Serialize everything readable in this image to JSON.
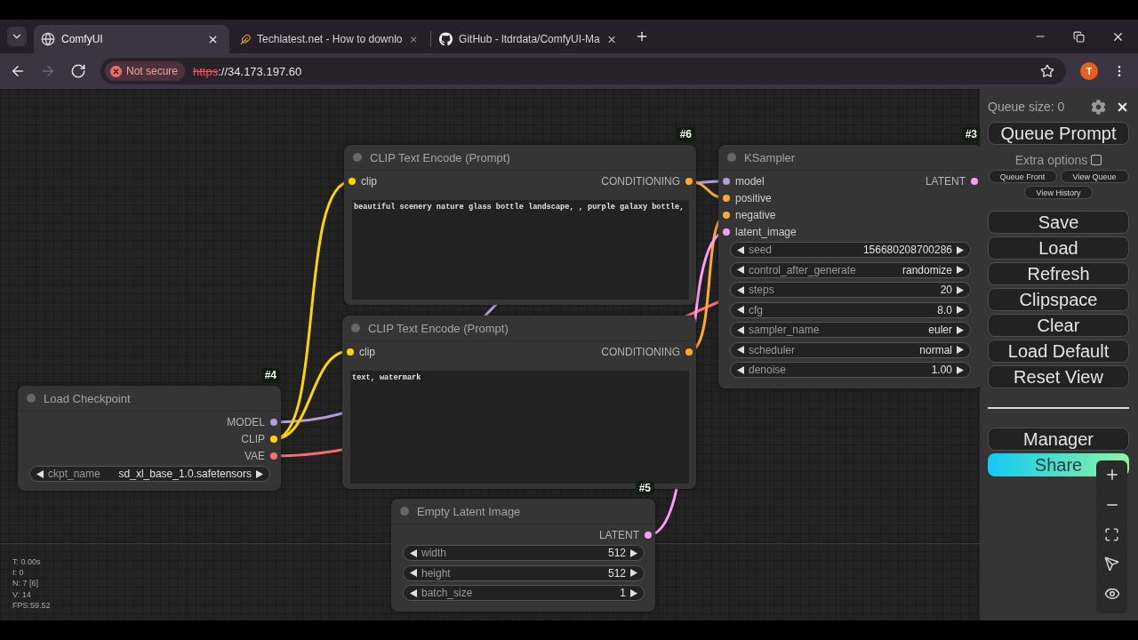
{
  "browser": {
    "tabs": [
      {
        "title": "ComfyUI",
        "selected": true
      },
      {
        "title": "Techlatest.net - How to downlo",
        "selected": false
      },
      {
        "title": "GitHub - ltdrdata/ComfyUI-Ma",
        "selected": false
      }
    ],
    "navigation": [
      {
        "kind": "back",
        "disabled": false
      },
      {
        "kind": "forward",
        "disabled": true
      },
      {
        "kind": "reload",
        "disabled": false
      }
    ],
    "security_chip": "Not secure",
    "url": {
      "scheme": "https",
      "rest": "://34.173.197.60"
    },
    "bookmarked": false,
    "profile_initial": "T"
  },
  "canvas": {
    "nodes": [
      {
        "badge": "#6",
        "title": "CLIP Text Encode (Prompt)",
        "inputs": [
          {
            "name": "clip",
            "color": "#ffd500"
          }
        ],
        "outputs": [
          {
            "name": "CONDITIONING",
            "color": "#ffa931"
          }
        ],
        "prompt": "beautiful scenery nature glass bottle landscape, , purple galaxy bottle,"
      },
      {
        "badge": "#3",
        "title": "KSampler",
        "inputs": [
          {
            "name": "model",
            "color": "#b39ddb"
          },
          {
            "name": "positive",
            "color": "#ffa931"
          },
          {
            "name": "negative",
            "color": "#ffa931"
          },
          {
            "name": "latent_image",
            "color": "#ff9cf9"
          }
        ],
        "outputs": [
          {
            "name": "LATENT",
            "color": "#ff9cf9"
          }
        ],
        "widgets": [
          {
            "name": "seed",
            "value": "156680208700286"
          },
          {
            "name": "control_after_generate",
            "value": "randomize"
          },
          {
            "name": "steps",
            "value": "20"
          },
          {
            "name": "cfg",
            "value": "8.0"
          },
          {
            "name": "sampler_name",
            "value": "euler"
          },
          {
            "name": "scheduler",
            "value": "normal"
          },
          {
            "name": "denoise",
            "value": "1.00"
          }
        ]
      },
      {
        "title": "CLIP Text Encode (Prompt)",
        "inputs": [
          {
            "name": "clip",
            "color": "#ffd500"
          }
        ],
        "outputs": [
          {
            "name": "CONDITIONING",
            "color": "#ffa931"
          }
        ],
        "prompt": "text, watermark"
      },
      {
        "badge": "#4",
        "title": "Load Checkpoint",
        "outputs": [
          {
            "name": "MODEL",
            "color": "#b39ddb"
          },
          {
            "name": "CLIP",
            "color": "#ffd500"
          },
          {
            "name": "VAE",
            "color": "#ff6e6e"
          }
        ],
        "widgets": [
          {
            "name": "ckpt_name",
            "value": "sd_xl_base_1.0.safetensors"
          }
        ]
      },
      {
        "badge": "#5",
        "title": "Empty Latent Image",
        "outputs": [
          {
            "name": "LATENT",
            "color": "#ff9cf9"
          }
        ],
        "widgets": [
          {
            "name": "width",
            "value": "512"
          },
          {
            "name": "height",
            "value": "512"
          },
          {
            "name": "batch_size",
            "value": "1"
          }
        ]
      }
    ],
    "stats": [
      "T: 0.00s",
      "I: 0",
      "N: 7 [6]",
      "V: 14",
      "FPS:59.52"
    ]
  },
  "menu": {
    "queue_size": "Queue size: 0",
    "queue_prompt": "Queue Prompt",
    "extra_options": {
      "label": "Extra options",
      "checked": false
    },
    "queue_actions": [
      "Queue Front",
      "View Queue",
      "View History"
    ],
    "buttons": [
      "Save",
      "Load",
      "Refresh",
      "Clipspace",
      "Clear",
      "Load Default",
      "Reset View"
    ],
    "extensions": [
      {
        "label": "Manager",
        "kind": "plain"
      },
      {
        "label": "Share",
        "kind": "gradient"
      }
    ]
  }
}
